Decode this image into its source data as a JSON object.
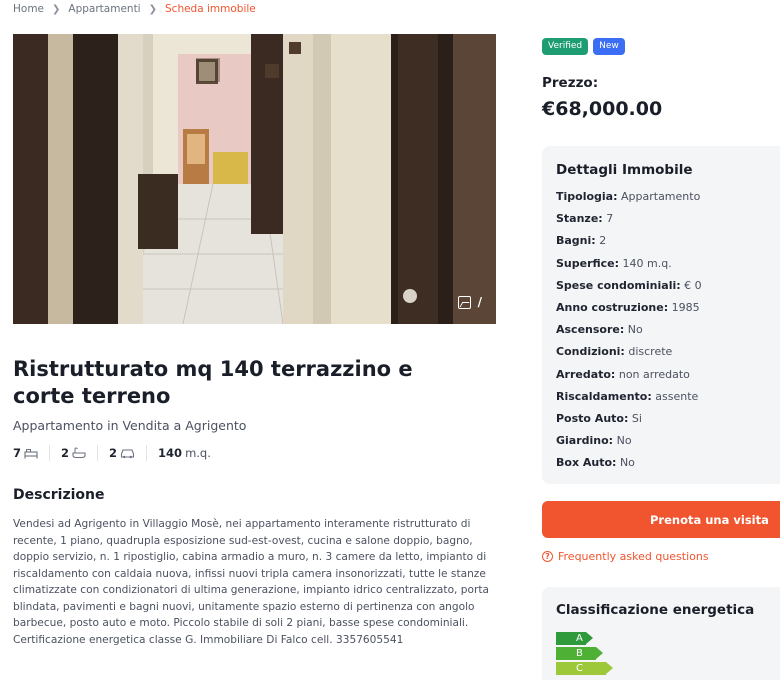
{
  "breadcrumb": {
    "home": "Home",
    "category": "Appartamenti",
    "current": "Scheda immobile"
  },
  "gallery": {
    "counter": "/"
  },
  "listing": {
    "title": "Ristrutturato mq 140 terrazzino e corte terreno",
    "subtitle": "Appartamento in Vendita a Agrigento",
    "features": {
      "rooms": "7",
      "baths": "2",
      "parking": "2",
      "area": "140",
      "area_unit": "m.q."
    },
    "description_heading": "Descrizione",
    "description": "Vendesi ad Agrigento in Villaggio Mosè, nei appartamento interamente ristrutturato di recente, 1 piano, quadrupla esposizione sud-est-ovest, cucina e salone doppio, bagno, doppio servizio, n. 1 ripostiglio, cabina armadio a muro, n. 3 camere da letto, impianto di riscaldamento con caldaia nuova, infissi nuovi tripla camera insonorizzati, tutte le stanze climatizzate con condizionatori di ultima generazione, impianto idrico centralizzato, porta blindata, pavimenti e bagni nuovi, unitamente spazio esterno di pertinenza con angolo barbecue, posto auto e moto. Piccolo stabile di soli 2 piani, basse spese condominiali. Certificazione energetica classe G. Immobiliare Di Falco cell. 3357605541"
  },
  "badges": {
    "verified": "Verified",
    "new": "New"
  },
  "price": {
    "label": "Prezzo:",
    "value": "€68,000.00"
  },
  "details": {
    "heading": "Dettagli Immobile",
    "rows": [
      {
        "label": "Tipologia:",
        "value": "Appartamento"
      },
      {
        "label": "Stanze:",
        "value": "7"
      },
      {
        "label": "Bagni:",
        "value": "2"
      },
      {
        "label": "Superfice:",
        "value": "140 m.q."
      },
      {
        "label": "Spese condominiali:",
        "value": "€ 0"
      },
      {
        "label": "Anno costruzione:",
        "value": "1985"
      },
      {
        "label": "Ascensore:",
        "value": "No"
      },
      {
        "label": "Condizioni:",
        "value": "discrete"
      },
      {
        "label": "Arredato:",
        "value": "non arredato"
      },
      {
        "label": "Riscaldamento:",
        "value": "assente"
      },
      {
        "label": "Posto Auto:",
        "value": "Si"
      },
      {
        "label": "Giardino:",
        "value": "No"
      },
      {
        "label": "Box Auto:",
        "value": "No"
      }
    ]
  },
  "cta": {
    "label": "Prenota una visita"
  },
  "faq": {
    "label": "Frequently asked questions"
  },
  "energy": {
    "heading": "Classificazione energetica",
    "classes": [
      {
        "label": "A",
        "color": "#2e9a3c"
      },
      {
        "label": "B",
        "color": "#4fb036"
      },
      {
        "label": "C",
        "color": "#9cc83a"
      }
    ]
  },
  "colors": {
    "accent": "#f0552f",
    "verified": "#1f9d72",
    "new": "#3b6ef5"
  }
}
